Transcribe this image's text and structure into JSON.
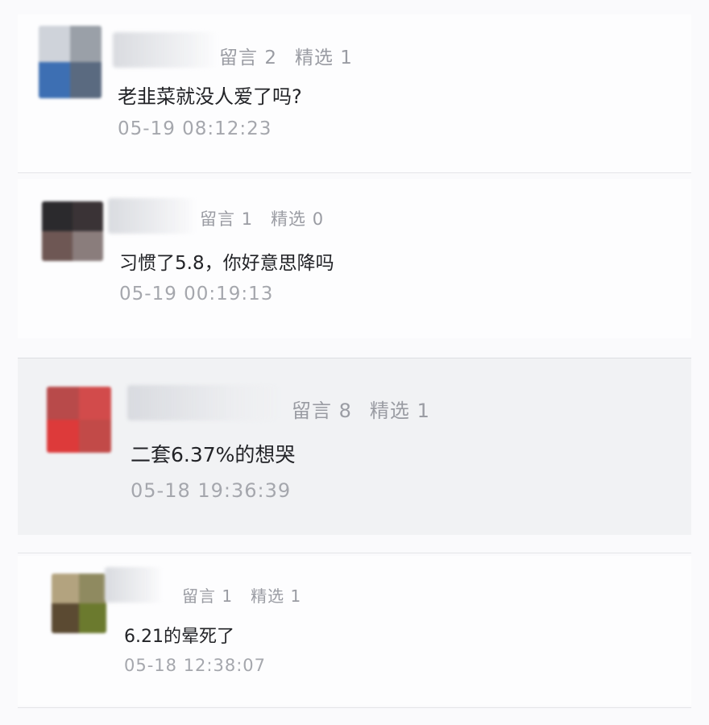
{
  "comments": [
    {
      "reply_label": "留言",
      "reply_count": "2",
      "featured_label": "精选",
      "featured_count": "1",
      "text": "老韭菜就没人爱了吗?",
      "time": "05-19 08:12:23",
      "avatar_colors": [
        "#cfd3da",
        "#9aa0a8",
        "#3d6fb3",
        "#5a6a80"
      ]
    },
    {
      "reply_label": "留言",
      "reply_count": "1",
      "featured_label": "精选",
      "featured_count": "0",
      "text": "习惯了5.8，你好意思降吗",
      "time": "05-19 00:19:13",
      "avatar_colors": [
        "#2b2a2d",
        "#3a3336",
        "#6e5754",
        "#8a7d7c"
      ]
    },
    {
      "reply_label": "留言",
      "reply_count": "8",
      "featured_label": "精选",
      "featured_count": "1",
      "text": "二套6.37%的想哭",
      "time": "05-18 19:36:39",
      "avatar_colors": [
        "#b84a4a",
        "#d24b4b",
        "#dd3a3a",
        "#c24a48"
      ]
    },
    {
      "reply_label": "留言",
      "reply_count": "1",
      "featured_label": "精选",
      "featured_count": "1",
      "text": "6.21的晕死了",
      "time": "05-18 12:38:07",
      "avatar_colors": [
        "#b3a37f",
        "#8f8a60",
        "#5b4a32",
        "#6b7a2e"
      ]
    }
  ]
}
